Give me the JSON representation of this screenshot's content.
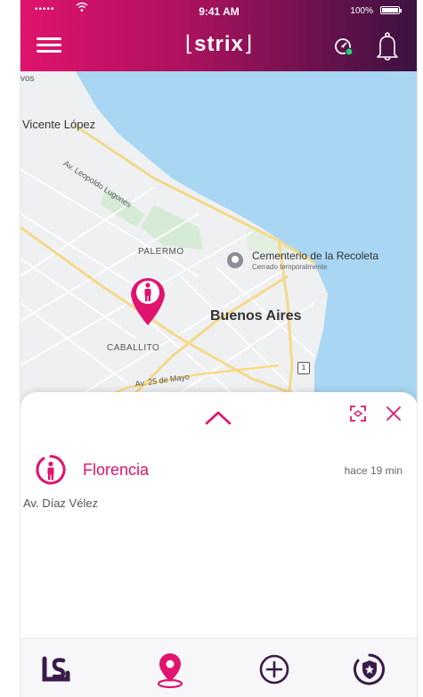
{
  "status_bar": {
    "signal": "•••••",
    "time": "9:41 AM",
    "battery": "100%"
  },
  "header": {
    "logo": "strix"
  },
  "map": {
    "labels": {
      "vos": "vos",
      "vicente_lopez": "Vicente López",
      "av_leopoldo_lugones": "Av. Leopoldo Lugones",
      "palermo": "PALERMO",
      "cementerio": "Cementerio de la Recoleta",
      "cementerio_sub": "Cerrado temporalmente",
      "buenos_aires": "Buenos Aires",
      "caballito": "CABALLITO",
      "av_25_mayo": "Av. 25 de Mayo",
      "route_1": "1"
    }
  },
  "sheet": {
    "member": {
      "name": "Florencia",
      "time": "hace 19 min",
      "address": "Av. Díaz Vélez"
    }
  },
  "colors": {
    "accent": "#e0136e",
    "header_gradient_start": "#e0136e",
    "header_gradient_end": "#3a1240",
    "speed_dot": "#2ecc71"
  },
  "icons": {
    "menu": "menu-icon",
    "speed": "speedometer-icon",
    "bell": "bell-icon",
    "person_marker": "person-pin-icon",
    "chevron_up": "chevron-up-icon",
    "fit": "fit-to-screen-icon",
    "close": "close-icon",
    "person_circle": "person-circle-icon",
    "tab_home": "strix-home-icon",
    "tab_map": "location-pin-icon",
    "tab_add": "add-circle-icon",
    "tab_shield": "shield-icon"
  }
}
